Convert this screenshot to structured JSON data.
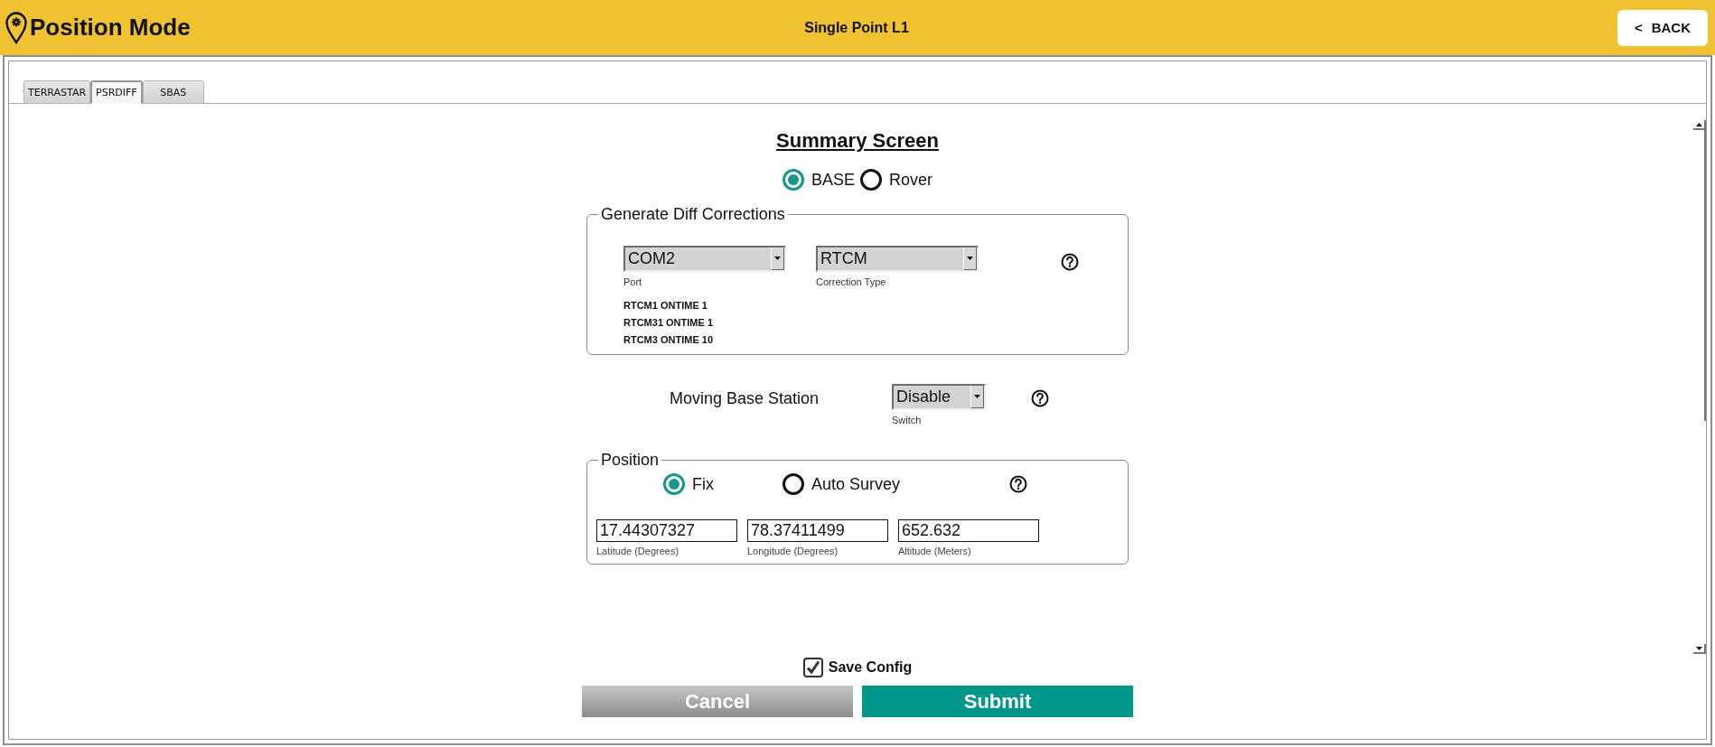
{
  "header": {
    "title": "Position Mode",
    "subtitle": "Single Point L1",
    "back_button": {
      "icon": "<",
      "label": "BACK"
    }
  },
  "tabs": [
    {
      "label": "TERRASTAR",
      "selected": false
    },
    {
      "label": "PSRDIFF",
      "selected": true
    },
    {
      "label": "SBAS",
      "selected": false
    }
  ],
  "summary": {
    "title": "Summary Screen",
    "modes": [
      {
        "label": "BASE",
        "selected": true
      },
      {
        "label": "Rover",
        "selected": false
      }
    ]
  },
  "diff_corrections": {
    "legend": "Generate Diff Corrections",
    "port": {
      "value": "COM2",
      "label": "Port"
    },
    "correction_type": {
      "value": "RTCM",
      "label": "Correction Type"
    },
    "messages": [
      "RTCM1 ONTIME 1",
      "RTCM31 ONTIME 1",
      "RTCM3 ONTIME 10"
    ]
  },
  "moving_base": {
    "label": "Moving Base Station",
    "switch": {
      "value": "Disable",
      "label": "Switch"
    }
  },
  "position": {
    "legend": "Position",
    "modes": [
      {
        "label": "Fix",
        "selected": true
      },
      {
        "label": "Auto Survey",
        "selected": false
      }
    ],
    "fields": [
      {
        "value": "17.44307327",
        "label": "Latitude (Degrees)"
      },
      {
        "value": "78.37411499",
        "label": "Longitude (Degrees)"
      },
      {
        "value": "652.632",
        "label": "Altitude (Meters)"
      }
    ]
  },
  "save_config": {
    "label": "Save Config",
    "checked": true
  },
  "buttons": [
    {
      "label": "Cancel",
      "kind": "secondary"
    },
    {
      "label": "Submit",
      "kind": "primary"
    }
  ]
}
